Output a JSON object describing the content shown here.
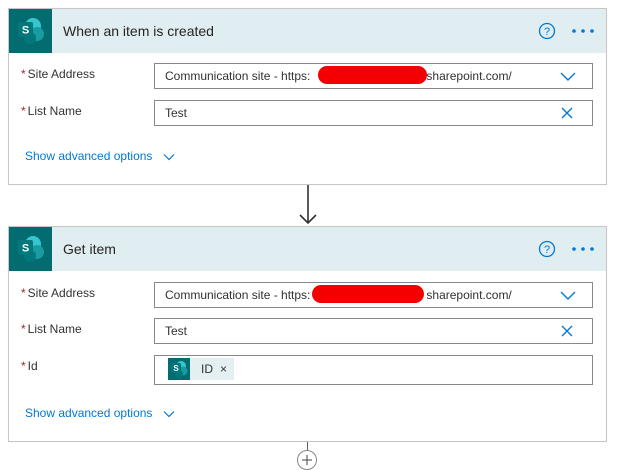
{
  "trigger_card": {
    "title": "When an item is created",
    "site_address_label": "Site Address",
    "site_address_prefix": "Communication site - https:",
    "site_address_suffix": "sharepoint.com/",
    "list_name_label": "List Name",
    "list_name_value": "Test",
    "advanced_label": "Show advanced options"
  },
  "action_card": {
    "title": "Get item",
    "site_address_label": "Site Address",
    "site_address_prefix": "Communication site - https:",
    "site_address_suffix": "sharepoint.com/",
    "list_name_label": "List Name",
    "list_name_value": "Test",
    "id_label": "Id",
    "id_token_label": "ID",
    "id_token_remove": "×",
    "advanced_label": "Show advanced options"
  },
  "required_marker": "*",
  "icons": {
    "connector": "sharepoint-icon",
    "help": "help-circle-icon",
    "more": "more-dots-icon",
    "dropdown": "chevron-down-icon",
    "clear": "close-icon",
    "flow_arrow": "arrow-down-icon",
    "add": "plus-icon"
  },
  "colors": {
    "header_bg": "#e1eef1",
    "sharepoint_teal": "#036c70",
    "accent_blue": "#0078d4",
    "required_red": "#a4262c",
    "redaction_red": "#f40000"
  }
}
